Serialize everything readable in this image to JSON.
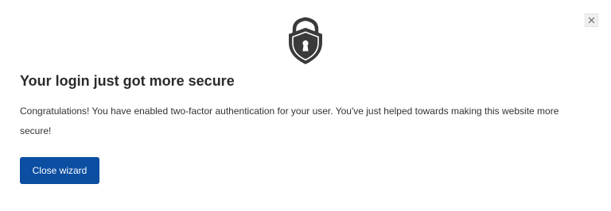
{
  "dialog": {
    "title": "Your login just got more secure",
    "message": "Congratulations! You have enabled two-factor authentication for your user. You've just helped towards making this website more secure!",
    "close_button_label": "Close wizard",
    "close_icon": "close-icon",
    "hero_icon": "shield-lock-icon"
  },
  "colors": {
    "primary": "#0b4ea2",
    "title_text": "#2b2b2b",
    "body_text": "#333333",
    "icon_dark": "#3a3a3a"
  }
}
